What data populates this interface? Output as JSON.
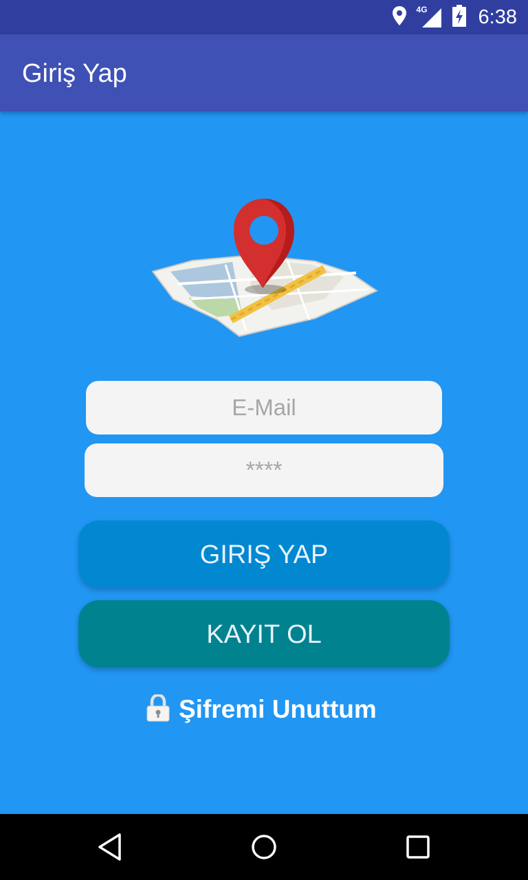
{
  "status_bar": {
    "time": "6:38",
    "network_label": "4G",
    "icons": [
      "location-icon",
      "signal-icon",
      "battery-icon"
    ]
  },
  "app_bar": {
    "title": "Giriş Yap",
    "background": "#3F51B5"
  },
  "logo": {
    "icon": "map-pin-icon"
  },
  "form": {
    "email_placeholder": "E-Mail",
    "password_placeholder": "****",
    "login_label": "GIRIŞ YAP",
    "register_label": "KAYIT OL",
    "forgot_label": "Şifremi Unuttum",
    "forgot_icon": "lock-icon"
  },
  "navigation": {
    "items": [
      "back-icon",
      "home-icon",
      "recents-icon"
    ]
  },
  "colors": {
    "background": "#2196F3",
    "status_bar": "#303F9F",
    "login_button": "#0288D1",
    "register_button": "#00838F",
    "input_background": "#F4F4F4"
  }
}
